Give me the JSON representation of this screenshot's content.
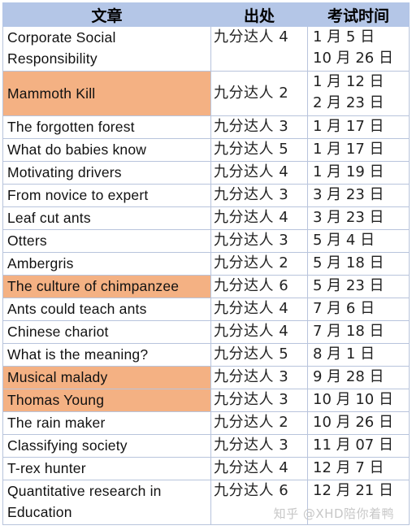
{
  "table": {
    "headers": [
      "文章",
      "出处",
      "考试时间"
    ],
    "highlight_color": "#f4b183",
    "header_color": "#b4c6e7",
    "rows": [
      {
        "title": "Corporate Social Responsibility",
        "title_lines": [
          "Corporate Social",
          "Responsibility"
        ],
        "source": "九分达人 4",
        "dates": [
          "1 月 5 日",
          "10 月 26 日"
        ],
        "highlighted": false
      },
      {
        "title": "Mammoth Kill",
        "title_lines": [
          "Mammoth Kill"
        ],
        "source": "九分达人 2",
        "dates": [
          "1 月 12 日",
          "2 月 23 日"
        ],
        "highlighted": true
      },
      {
        "title": "The forgotten forest",
        "title_lines": [
          "The forgotten forest"
        ],
        "source": "九分达人 3",
        "dates": [
          "1 月 17 日"
        ],
        "highlighted": false
      },
      {
        "title": "What do babies know",
        "title_lines": [
          "What do babies know"
        ],
        "source": "九分达人 5",
        "dates": [
          "1 月 17 日"
        ],
        "highlighted": false
      },
      {
        "title": "Motivating drivers",
        "title_lines": [
          "Motivating drivers"
        ],
        "source": "九分达人 4",
        "dates": [
          "1 月 19 日"
        ],
        "highlighted": false
      },
      {
        "title": "From novice to expert",
        "title_lines": [
          "From novice to expert"
        ],
        "source": "九分达人 3",
        "dates": [
          "3 月 23 日"
        ],
        "highlighted": false
      },
      {
        "title": "Leaf cut ants",
        "title_lines": [
          "Leaf cut ants"
        ],
        "source": "九分达人 4",
        "dates": [
          "3 月 23 日"
        ],
        "highlighted": false
      },
      {
        "title": "Otters",
        "title_lines": [
          "Otters"
        ],
        "source": "九分达人 3",
        "dates": [
          "5 月 4 日"
        ],
        "highlighted": false
      },
      {
        "title": "Ambergris",
        "title_lines": [
          "Ambergris"
        ],
        "source": "九分达人 2",
        "dates": [
          "5 月 18 日"
        ],
        "highlighted": false
      },
      {
        "title": "The culture of chimpanzee",
        "title_lines": [
          "The culture of chimpanzee"
        ],
        "source": "九分达人 6",
        "dates": [
          "5 月 23 日"
        ],
        "highlighted": true
      },
      {
        "title": "Ants could teach ants",
        "title_lines": [
          "Ants could teach ants"
        ],
        "source": "九分达人 4",
        "dates": [
          "7 月 6 日"
        ],
        "highlighted": false
      },
      {
        "title": "Chinese chariot",
        "title_lines": [
          "Chinese chariot"
        ],
        "source": "九分达人 4",
        "dates": [
          "7 月 18 日"
        ],
        "highlighted": false
      },
      {
        "title": "What is the meaning?",
        "title_lines": [
          "What is the meaning?"
        ],
        "source": "九分达人 5",
        "dates": [
          "8 月 1 日"
        ],
        "highlighted": false
      },
      {
        "title": "Musical malady",
        "title_lines": [
          "Musical malady"
        ],
        "source": "九分达人 3",
        "dates": [
          "9 月 28 日"
        ],
        "highlighted": true
      },
      {
        "title": "Thomas Young",
        "title_lines": [
          "Thomas Young"
        ],
        "source": "九分达人 3",
        "dates": [
          "10 月 10 日"
        ],
        "highlighted": true
      },
      {
        "title": "The rain maker",
        "title_lines": [
          "The rain maker"
        ],
        "source": "九分达人 2",
        "dates": [
          "10 月 26 日"
        ],
        "highlighted": false
      },
      {
        "title": "Classifying society",
        "title_lines": [
          "Classifying society"
        ],
        "source": "九分达人 3",
        "dates": [
          "11 月 07 日"
        ],
        "highlighted": false
      },
      {
        "title": "T-rex hunter",
        "title_lines": [
          "T-rex hunter"
        ],
        "source": "九分达人 4",
        "dates": [
          "12 月 7 日"
        ],
        "highlighted": false
      },
      {
        "title": "Quantitative research in Education",
        "title_lines": [
          "Quantitative research in",
          "Education"
        ],
        "source": "九分达人 6",
        "dates": [
          "12 月 21 日"
        ],
        "highlighted": false
      }
    ]
  },
  "watermark": "知乎 @XHD陪你着鸭"
}
